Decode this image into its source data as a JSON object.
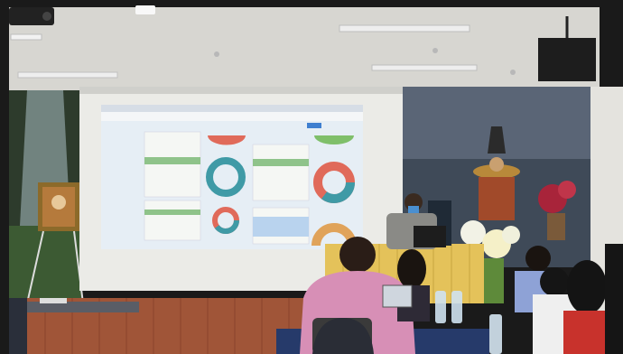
{
  "scene": {
    "description_tag": "presentation",
    "colors": {
      "ceiling": "#d9d9d6",
      "wall_top": "#e7e6e1",
      "screen": "#f2f2f0",
      "projected_slide": "#e9f0f6",
      "curtain_gold": "#e6c65a",
      "stage_wood": "#a0553a",
      "pink_shirt": "#d98fb5",
      "dark_room": "#1b1b1b"
    },
    "icons": {
      "projector": "projector-icon",
      "speaker": "speaker-icon",
      "laptop": "laptop-icon",
      "bottle": "water-bottle-icon"
    }
  }
}
